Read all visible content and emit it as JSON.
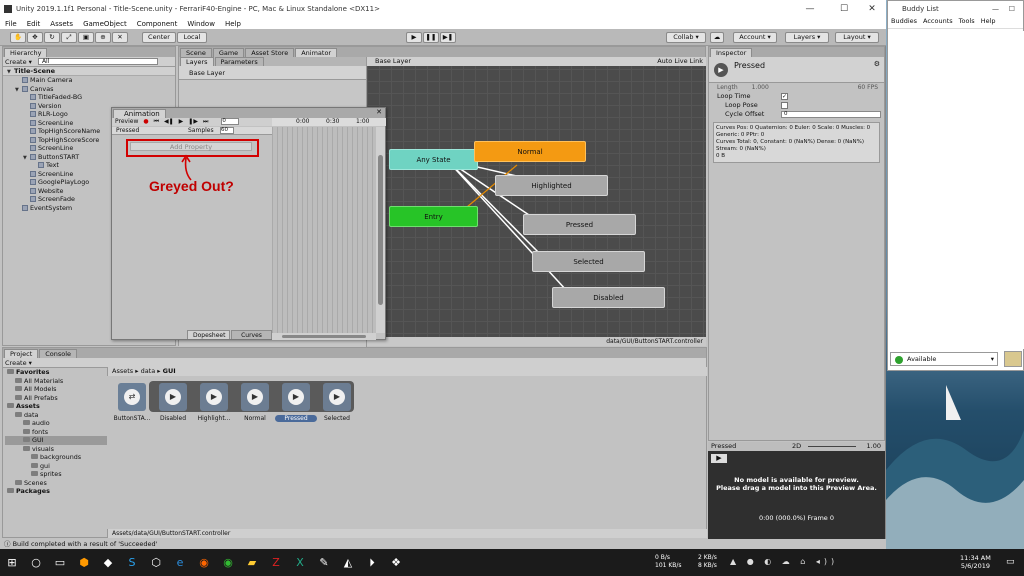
{
  "window": {
    "title": "Unity 2019.1.1f1 Personal - Title-Scene.unity - FerrariF40-Engine - PC, Mac & Linux Standalone <DX11>"
  },
  "menu": [
    "File",
    "Edit",
    "Assets",
    "GameObject",
    "Component",
    "Window",
    "Help"
  ],
  "toolbar": {
    "center": "Center",
    "local": "Local",
    "collab": "Collab ▾",
    "account": "Account ▾",
    "layers": "Layers ▾",
    "layout": "Layout ▾"
  },
  "hierarchy": {
    "tab": "Hierarchy",
    "create": "Create ▾",
    "search": "All",
    "scene": "Title-Scene",
    "items": [
      {
        "label": "Main Camera",
        "indent": 1
      },
      {
        "label": "Canvas",
        "indent": 1,
        "exp": true
      },
      {
        "label": "TitleFaded-BG",
        "indent": 2
      },
      {
        "label": "Version",
        "indent": 2
      },
      {
        "label": "RLR-Logo",
        "indent": 2
      },
      {
        "label": "ScreenLine",
        "indent": 2
      },
      {
        "label": "TopHighScoreName",
        "indent": 2
      },
      {
        "label": "TopHighScoreScore",
        "indent": 2
      },
      {
        "label": "ScreenLine",
        "indent": 2
      },
      {
        "label": "ButtonSTART",
        "indent": 2,
        "exp": true
      },
      {
        "label": "Text",
        "indent": 3
      },
      {
        "label": "ScreenLine",
        "indent": 2
      },
      {
        "label": "GooglePlayLogo",
        "indent": 2
      },
      {
        "label": "Website",
        "indent": 2
      },
      {
        "label": "ScreenFade",
        "indent": 2
      },
      {
        "label": "EventSystem",
        "indent": 1
      }
    ]
  },
  "center_tabs": [
    "Scene",
    "Game",
    "Asset Store",
    "Animator"
  ],
  "animator": {
    "tabs": [
      "Layers",
      "Parameters"
    ],
    "base_layer": "Base Layer",
    "breadcrumb": "Base Layer",
    "auto_live": "Auto Live Link",
    "footer": "data/GUI/ButtonSTART.controller",
    "nodes": {
      "any": "Any State",
      "entry": "Entry",
      "normal": "Normal",
      "highlighted": "Highlighted",
      "pressed": "Pressed",
      "selected": "Selected",
      "disabled": "Disabled"
    }
  },
  "animation": {
    "tab": "Animation",
    "preview": "Preview",
    "frame": "0",
    "clip": "Pressed",
    "samples_label": "Samples",
    "samples": "60",
    "add_property": "Add Property",
    "times": [
      "0:00",
      "0:30",
      "1:00"
    ],
    "dopesheet": "Dopesheet",
    "curves": "Curves"
  },
  "annotation": "Greyed Out?",
  "inspector": {
    "tab": "Inspector",
    "name": "Pressed",
    "length_label": "Length",
    "length": "1.000",
    "fps": "60 FPS",
    "loop_time": "Loop Time",
    "loop_pose": "Loop Pose",
    "cycle_offset": "Cycle Offset",
    "cycle_value": "0",
    "info": [
      "Curves Pos: 0 Quaternion: 0 Euler: 0 Scale: 0 Muscles: 0",
      "Generic: 0 PPtr: 0",
      "Curves Total: 0, Constant: 0 (NaN%) Dense: 0 (NaN%)",
      "Stream: 0 (NaN%)",
      "0 B"
    ]
  },
  "preview": {
    "label": "Pressed",
    "twod": "2D",
    "speed": "1.00",
    "msg1": "No model is available for preview.",
    "msg2": "Please drag a model into this Preview Area.",
    "time": "0:00 (000.0%) Frame 0"
  },
  "project": {
    "tabs": [
      "Project",
      "Console"
    ],
    "create": "Create ▾",
    "tree": [
      {
        "label": "Favorites",
        "indent": 0,
        "bold": true
      },
      {
        "label": "All Materials",
        "indent": 1
      },
      {
        "label": "All Models",
        "indent": 1
      },
      {
        "label": "All Prefabs",
        "indent": 1
      },
      {
        "label": "Assets",
        "indent": 0,
        "bold": true
      },
      {
        "label": "data",
        "indent": 1
      },
      {
        "label": "audio",
        "indent": 2
      },
      {
        "label": "fonts",
        "indent": 2
      },
      {
        "label": "GUI",
        "indent": 2,
        "sel": true
      },
      {
        "label": "visuals",
        "indent": 2
      },
      {
        "label": "backgrounds",
        "indent": 3
      },
      {
        "label": "gui",
        "indent": 3
      },
      {
        "label": "sprites",
        "indent": 3
      },
      {
        "label": "Scenes",
        "indent": 1
      },
      {
        "label": "Packages",
        "indent": 0,
        "bold": true
      }
    ],
    "breadcrumb": [
      "Assets",
      "data",
      "GUI"
    ],
    "assets": [
      "ButtonSTA...",
      "Disabled",
      "Highlight...",
      "Normal",
      "Pressed",
      "Selected"
    ],
    "path": "Assets/data/GUI/ButtonSTART.controller"
  },
  "status": "Build completed with a result of 'Succeeded'",
  "buddy": {
    "title": "Buddy List",
    "menu": [
      "Buddies",
      "Accounts",
      "Tools",
      "Help"
    ],
    "status": "Available"
  },
  "taskbar": {
    "net1": "0 B/s",
    "net2": "101 KB/s",
    "net3": "2 KB/s",
    "net4": "8 KB/s",
    "time": "11:34 AM",
    "date": "5/6/2019"
  }
}
